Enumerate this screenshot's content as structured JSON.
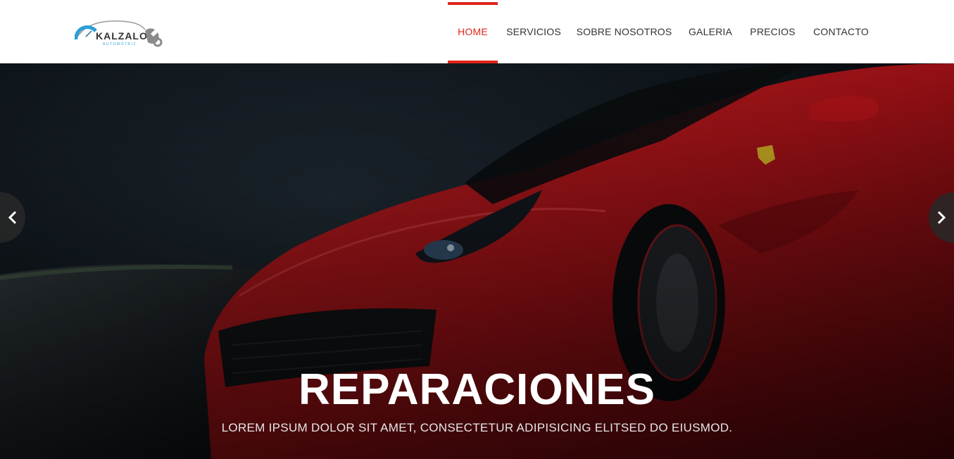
{
  "brand": {
    "logo_text": "KALZALO",
    "logo_subtext": "AUTOMOTRIZ"
  },
  "nav": {
    "items": [
      {
        "label": "HOME",
        "active": true
      },
      {
        "label": "SERVICIOS",
        "active": false
      },
      {
        "label": "SOBRE NOSOTROS",
        "active": false
      },
      {
        "label": "GALERIA",
        "active": false
      },
      {
        "label": "PRECIOS",
        "active": false
      },
      {
        "label": "CONTACTO",
        "active": false
      }
    ]
  },
  "hero": {
    "title": "REPARACIONES",
    "subtitle": "LOREM IPSUM DOLOR SIT AMET, CONSECTETUR ADIPISICING ELITSED DO EIUSMOD.",
    "prev_icon": "chevron-left-icon",
    "next_icon": "chevron-right-icon"
  },
  "colors": {
    "accent": "#e0251b",
    "top_line": "#0f6f6f",
    "car": "#b5141a"
  }
}
